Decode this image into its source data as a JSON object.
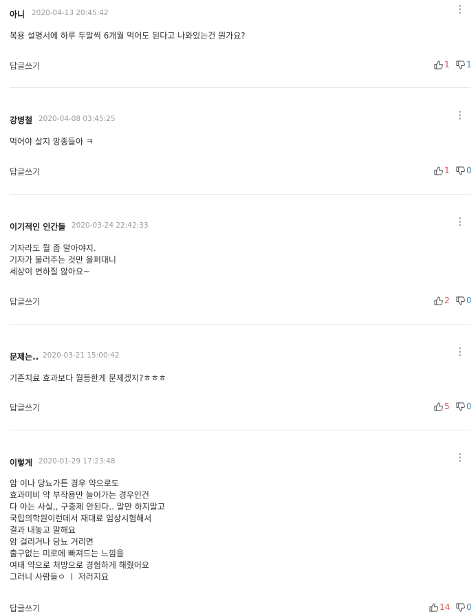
{
  "comments": [
    {
      "nickname": "아니",
      "date": "2020-04-13 20:45:42",
      "lines": [
        "복용 설명서에 하루 두알씩 6개월 먹어도 된다고 나와있는건 뭔가요?"
      ],
      "reply_label": "답글쓰기",
      "likes": "1",
      "dislikes": "1"
    },
    {
      "nickname": "강병철",
      "date": "2020-04-08 03:45:25",
      "lines": [
        "먹어야 살지 망종들아 ㅋ"
      ],
      "reply_label": "답글쓰기",
      "likes": "1",
      "dislikes": "0"
    },
    {
      "nickname": "이기적인 인간들",
      "date": "2020-03-24 22:42:33",
      "lines": [
        "기자라도 뭘 좀 알아야지.",
        "기자가 불러주는 것만 올퍼대니",
        "세상이 변하질 않아요~"
      ],
      "reply_label": "답글쓰기",
      "likes": "2",
      "dislikes": "0"
    },
    {
      "nickname": "문제는..",
      "date": "2020-03-21 15:00:42",
      "lines": [
        "기존치료 효과보다 월등한게 문제겠지?ㅎㅎㅎ"
      ],
      "reply_label": "답글쓰기",
      "likes": "5",
      "dislikes": "0"
    },
    {
      "nickname": "이렇게",
      "date": "2020-01-29 17:23:48",
      "lines": [
        "암 이나 당뇨가튼 경우 약으로도",
        "효과미비 약 부작용만 늘어가는 경우인건",
        "다 아는 사실,, 구충제 안된다.. 말만 하지말고",
        "국립의학원이런데서 재대료 임상시험해서",
        "결과 내놓고 말해요",
        "암 걸리거나 당뇨 거리면",
        "출구없는 미로에 빠져드는 느낌을",
        "여태 약으로 처방으로 경험하게 해줬어요",
        "그러니 사람들ㅇ ㅣ 저러지요"
      ],
      "reply_label": "답글쓰기",
      "likes": "14",
      "dislikes": "0"
    }
  ],
  "icons": {
    "more": "more-vertical-icon",
    "like": "thumbs-up-icon",
    "dislike": "thumbs-down-icon"
  },
  "colors": {
    "like_count": "#d9534f",
    "dislike_count": "#3b8bc8",
    "date": "#9a9a9a",
    "divider": "#e6e6e6"
  }
}
